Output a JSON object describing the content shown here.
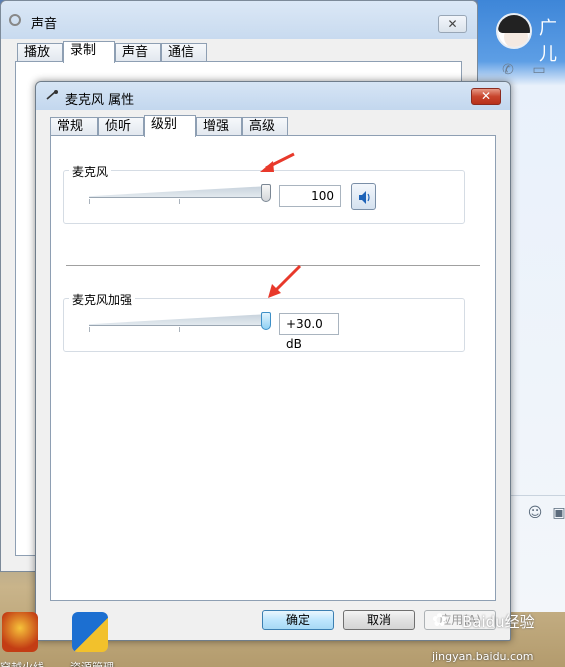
{
  "sound_window": {
    "title": "声音",
    "close_label": "✕",
    "tabs": [
      "播放",
      "录制",
      "声音",
      "通信"
    ],
    "active_tab": 1
  },
  "dialog": {
    "title": "麦克风 属性",
    "close_label": "✕",
    "tabs": [
      "常规",
      "侦听",
      "级别",
      "增强",
      "高级"
    ],
    "active_tab": 2,
    "microphone": {
      "label": "麦克风",
      "value": "100",
      "level_fraction": 1.0
    },
    "boost": {
      "label": "麦克风加强",
      "value": "+30.0 dB",
      "level_fraction": 1.0
    },
    "buttons": {
      "ok": "确定",
      "cancel": "取消",
      "apply": "应用(A)"
    }
  },
  "chat_window": {
    "name": "广儿"
  },
  "desktop_icons": [
    {
      "name": "cf-icon",
      "label": "穿越火线"
    },
    {
      "name": "shortcut-icon",
      "label": "资源管理"
    }
  ],
  "watermark": {
    "brand": "Baidu经验",
    "url": "jingyan.baidu.com"
  },
  "colors": {
    "accent_arrow": "#e8392b",
    "dialog_close": "#c8452d",
    "boost_thumb": "#8fd0f4"
  }
}
